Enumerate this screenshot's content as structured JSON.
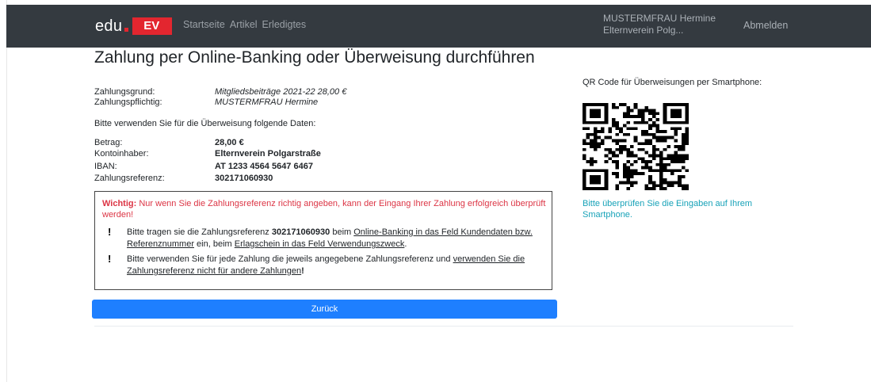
{
  "nav": {
    "brand_edu": "edu",
    "brand_ev": "EV",
    "links": [
      "Startseite",
      "Artikel",
      "Erledigtes"
    ],
    "user_name": "MUSTERMFRAU Hermine",
    "user_org": "Elternverein Polg...",
    "logout": "Abmelden"
  },
  "title": "Zahlung per Online-Banking oder Überweisung durchführen",
  "payment": {
    "reason_label": "Zahlungsgrund:",
    "reason_value": "Mitgliedsbeiträge 2021-22 28,00 €",
    "payer_label": "Zahlungspflichtig:",
    "payer_value": "MUSTERMFRAU Hermine"
  },
  "instruction": "Bitte verwenden Sie für die Überweisung folgende Daten:",
  "transfer": {
    "amount_label": "Betrag:",
    "amount_value": "28,00 €",
    "holder_label": "Kontoinhaber:",
    "holder_value": "Elternverein Polgarstraße",
    "iban_label": "IBAN:",
    "iban_value": "AT 1233 4564 5647 6467",
    "ref_label": "Zahlungsreferenz:",
    "ref_value": "302171060930"
  },
  "warning": {
    "strong": "Wichtig:",
    "text": "Nur wenn Sie die Zahlungsreferenz richtig angeben, kann der Eingang Ihrer Zahlung erfolgreich überprüft werden!",
    "b1_pre": "Bitte tragen sie die Zahlungsreferenz",
    "b1_ref": "302171060930",
    "b1_mid1": "beim",
    "b1_u1": "Online-Banking in das Feld Kundendaten bzw. Referenznummer",
    "b1_mid2": "ein, beim",
    "b1_u2": "Erlagschein in das Feld Verwendungszweck",
    "b1_end": ".",
    "b2_pre": "Bitte verwenden Sie für jede Zahlung die jeweils angegebene Zahlungsreferenz und",
    "b2_u": "verwenden Sie die Zahlungsreferenz nicht für andere Zahlungen",
    "b2_end": "!"
  },
  "back_button": "Zurück",
  "qr": {
    "label": "QR Code für Überweisungen per Smartphone:",
    "note": "Bitte überprüfen Sie die Eingaben auf Ihrem Smartphone."
  },
  "colors": {
    "navbar": "#343a40",
    "brand_red": "#e3262f",
    "primary": "#1e7fff",
    "warning_red": "#dc3545",
    "info_teal": "#17a2b8"
  }
}
